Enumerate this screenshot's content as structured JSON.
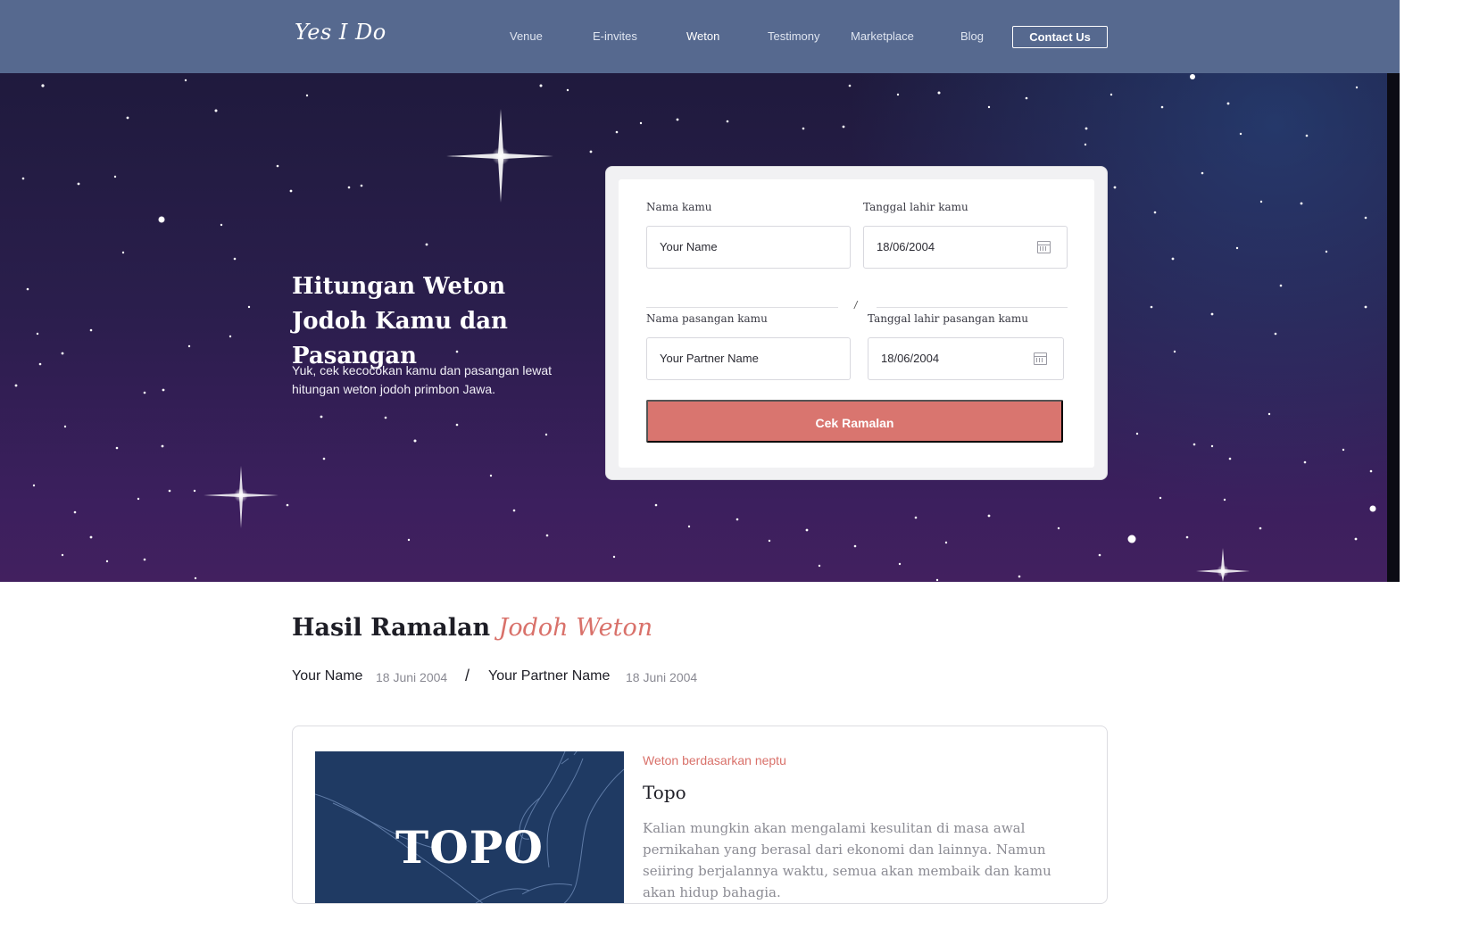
{
  "nav": {
    "logo": "Yes I Do",
    "items": [
      {
        "label": "Venue"
      },
      {
        "label": "E-invites"
      },
      {
        "label": "Weton"
      },
      {
        "label": "Testimony"
      },
      {
        "label": "Marketplace"
      },
      {
        "label": "Blog"
      }
    ],
    "contact_label": "Contact Us",
    "active_item": "Weton"
  },
  "hero": {
    "title": "Hitungan Weton Jodoh Kamu dan Pasangan",
    "subtitle": "Yuk, cek kecocokan kamu dan pasangan lewat hitungan weton jodoh primbon Jawa."
  },
  "form": {
    "name_label": "Nama kamu",
    "name_value": "Your Name",
    "dob_label": "Tanggal lahir kamu",
    "dob_value": "18/06/2004",
    "separator": "/",
    "partner_label": "Nama pasangan kamu",
    "partner_value": "Your Partner Name",
    "partner_dob_label": "Tanggal lahir pasangan kamu",
    "partner_dob_value": "18/06/2004",
    "submit_label": "Cek Ramalan"
  },
  "result": {
    "title_main": "Hasil Ramalan",
    "title_accent": "Jodoh Weton",
    "name": "Your Name",
    "name_date": "18 Juni 2004",
    "separator": "/",
    "partner": "Your Partner Name",
    "partner_date": "18 Juni 2004"
  },
  "card": {
    "image_text": "TOPO",
    "kicker": "Weton berdasarkan neptu",
    "name": "Topo",
    "description": "Kalian mungkin akan mengalami kesulitan di masa awal pernikahan yang berasal dari ekonomi dan lainnya. Namun seiiring berjalannya waktu, semua akan membaik dan kamu akan hidup bahagia."
  },
  "colors": {
    "nav_bg": "#56698f",
    "accent": "#d9716a",
    "button": "#d9756f",
    "card_image_bg": "#1f3a63"
  },
  "icons": {
    "date_picker": "calendar-icon"
  }
}
